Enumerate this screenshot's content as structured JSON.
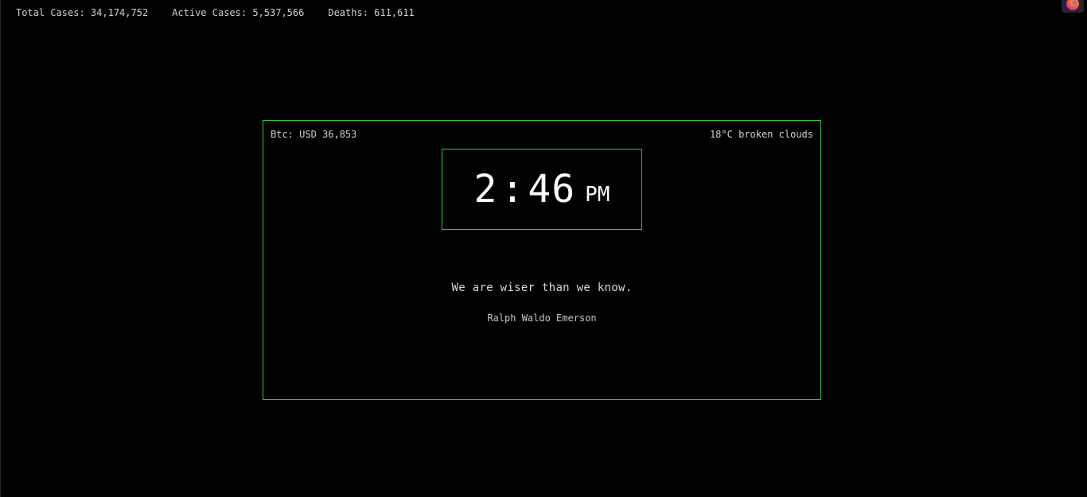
{
  "stats": {
    "total_cases": "Total Cases: 34,174,752",
    "active_cases": "Active Cases: 5,537,566",
    "deaths": "Deaths: 611,611"
  },
  "extension": {
    "icon": "firefox-icon"
  },
  "dashboard": {
    "btc": "Btc: USD 36,853",
    "weather": "18°C broken clouds",
    "clock": {
      "hour": "2",
      "separator": ":",
      "minutes": "46",
      "ampm": "PM"
    },
    "quote": "We are wiser than we know.",
    "author": "Ralph Waldo Emerson"
  },
  "colors": {
    "background": "#000000",
    "accent_border": "#2ecc40",
    "text": "#d8d8d8"
  }
}
